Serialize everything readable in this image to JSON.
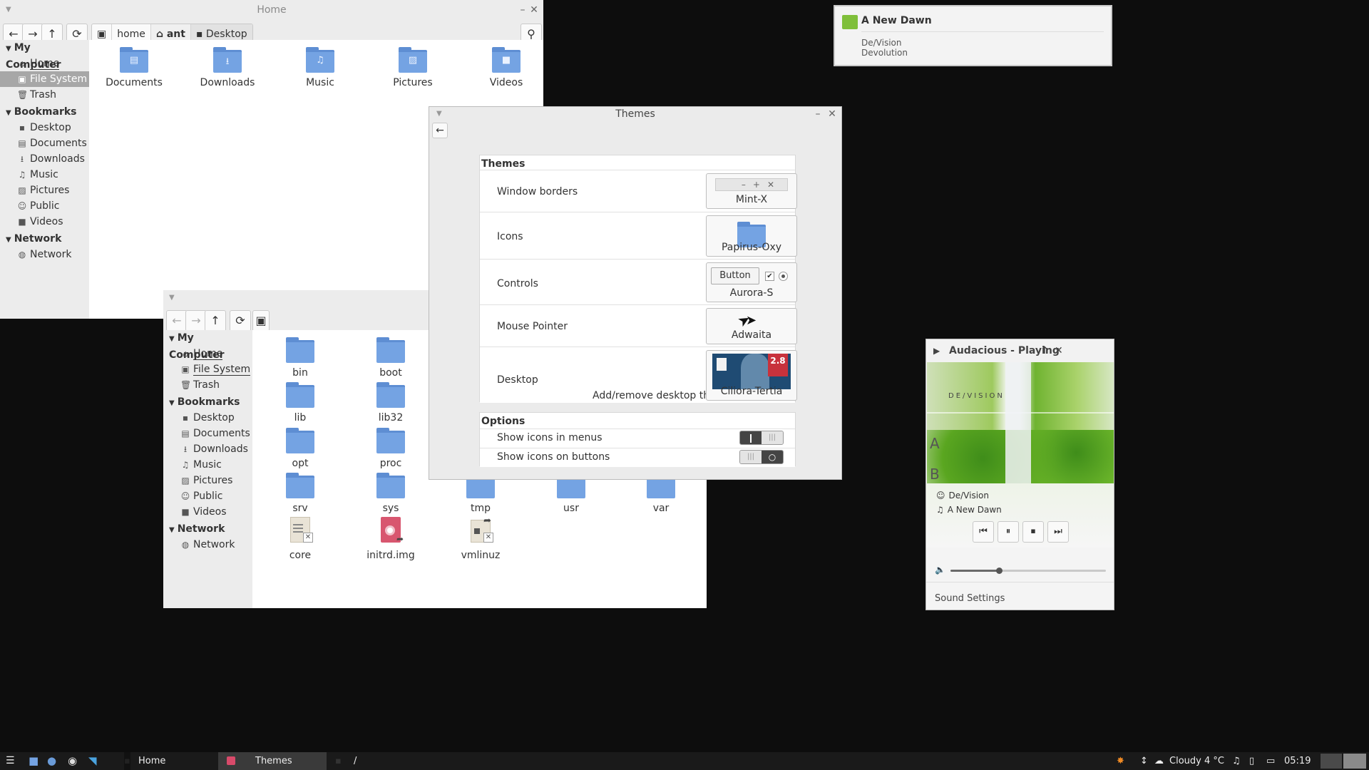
{
  "notification": {
    "title": "A New Dawn",
    "artist": "De/Vision",
    "album": "Devolution"
  },
  "home_window": {
    "title": "Home",
    "breadcrumbs": [
      "home",
      "ant",
      "Desktop"
    ],
    "sidebar": {
      "my_computer": "My Computer",
      "mc_items": [
        "Home",
        "File System",
        "Trash"
      ],
      "bookmarks": "Bookmarks",
      "bm_items": [
        "Desktop",
        "Documents",
        "Downloads",
        "Music",
        "Pictures",
        "Public",
        "Videos"
      ],
      "network": "Network",
      "net_items": [
        "Network"
      ]
    },
    "files": [
      "Documents",
      "Downloads",
      "Music",
      "Pictures",
      "Videos"
    ]
  },
  "root_window": {
    "breadcrumb": "/",
    "sidebar": {
      "my_computer": "My Computer",
      "mc_items": [
        "Home",
        "File System",
        "Trash"
      ],
      "bookmarks": "Bookmarks",
      "bm_items": [
        "Desktop",
        "Documents",
        "Downloads",
        "Music",
        "Pictures",
        "Public",
        "Videos"
      ],
      "network": "Network",
      "net_items": [
        "Network"
      ]
    },
    "folders": [
      "bin",
      "boot",
      "lib",
      "lib32",
      "opt",
      "proc",
      "srv",
      "sys",
      "tmp",
      "usr",
      "var"
    ],
    "files": [
      "core",
      "initrd.img",
      "vmlinuz"
    ]
  },
  "themes_window": {
    "title": "Themes",
    "section_themes": "Themes",
    "rows": {
      "window_borders": {
        "label": "Window borders",
        "value": "Mint-X"
      },
      "icons": {
        "label": "Icons",
        "value": "Papirus-Oxy"
      },
      "controls": {
        "label": "Controls",
        "value": "Aurora-S",
        "preview_button": "Button"
      },
      "pointer": {
        "label": "Mouse Pointer",
        "value": "Adwaita"
      },
      "desktop": {
        "label": "Desktop",
        "value": "Ciliora-Tertia",
        "link": "Add/remove desktop themes...",
        "badge": "2.8"
      }
    },
    "section_options": "Options",
    "options": {
      "icons_in_menus": {
        "label": "Show icons in menus",
        "on": true
      },
      "icons_on_buttons": {
        "label": "Show icons on buttons",
        "on": false
      }
    }
  },
  "player": {
    "title": "Audacious - Playing",
    "album_art_text": "DE/VISION",
    "artist": "De/Vision",
    "track": "A New Dawn",
    "volume_level": 0.31,
    "sound_settings": "Sound Settings"
  },
  "taskbar": {
    "tasks": [
      "Home",
      "Themes",
      "/"
    ],
    "weather": "Cloudy 4 °C",
    "clock": "05:19"
  }
}
